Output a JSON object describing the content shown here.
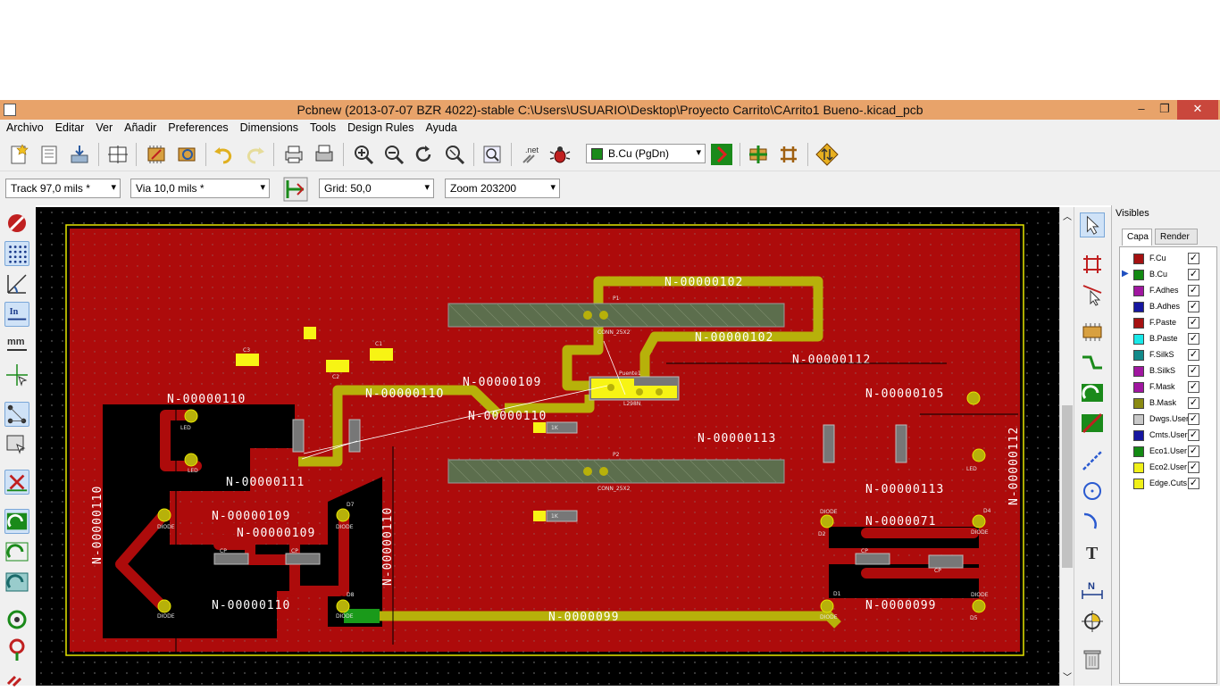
{
  "window": {
    "title": "Pcbnew (2013-07-07 BZR 4022)-stable C:\\Users\\USUARIO\\Desktop\\Proyecto Carrito\\CArrito1 Bueno-.kicad_pcb",
    "minimize": "–",
    "maximize": "❐",
    "close": "✕"
  },
  "menu": [
    "Archivo",
    "Editar",
    "Ver",
    "Añadir",
    "Preferences",
    "Dimensions",
    "Tools",
    "Design Rules",
    "Ayuda"
  ],
  "toolbar": {
    "layer_select": "B.Cu (PgDn)",
    "netlist_label": ".net"
  },
  "toolbar2": {
    "track": "Track 97,0 mils *",
    "via": "Via 10,0 mils *",
    "grid": "Grid: 50,0",
    "zoom": "Zoom 203200"
  },
  "colors": {
    "board": "#ad0b0b",
    "track": "#b7b10a",
    "pad": "#f7f414",
    "edge": "#e6e600",
    "ratsnest": "#ffffff"
  },
  "pcb": {
    "nets": {
      "n102a": "N-00000102",
      "n102b": "N-00000102",
      "n112a": "N-00000112",
      "n112b": "N-00000112",
      "n105": "N-00000105",
      "n110a": "N-00000110",
      "n110b": "N-0000011O",
      "n109a": "N-00000109",
      "n110c": "N-00000110",
      "n113a": "N-00000113",
      "n113b": "N-00000113",
      "n111": "N-00000111",
      "n109b": "N-00000109",
      "n109c": "N-00000109",
      "n110d": "N-00000110",
      "n110e": "N-00000110",
      "n110f": "N-00000110",
      "n071": "N-0000071",
      "n099a": "N-0000099",
      "n099b": "N-0000099"
    },
    "parts": {
      "p1": "P1",
      "p2": "P2",
      "conn1": "CONN_25X2",
      "conn2": "CONN_25X2",
      "puente": "Puente1",
      "l298": "L298N",
      "c2": "C2",
      "c3": "C3",
      "c1": "C1",
      "r1k_a": "1K",
      "r1k_b": "1K",
      "led": "LED",
      "diode": "DIODE",
      "d1": "D1",
      "d2": "D2",
      "d4": "D4",
      "d5": "D5",
      "d7": "D7",
      "d8": "D8",
      "cp": "CP"
    }
  },
  "layers_panel": {
    "title": "Visibles",
    "tabs": [
      "Capa",
      "Render"
    ],
    "layers": [
      {
        "name": "F.Cu",
        "color": "#a51111",
        "checked": "✓"
      },
      {
        "name": "B.Cu",
        "color": "#138a13",
        "checked": "✓",
        "active": true
      },
      {
        "name": "F.Adhes",
        "color": "#a016a0",
        "checked": "✓"
      },
      {
        "name": "B.Adhes",
        "color": "#1616a0",
        "checked": "✓"
      },
      {
        "name": "F.Paste",
        "color": "#a51111",
        "checked": "✓"
      },
      {
        "name": "B.Paste",
        "color": "#18e8e8",
        "checked": "✓"
      },
      {
        "name": "F.SilkS",
        "color": "#128a8a",
        "checked": "✓"
      },
      {
        "name": "B.SilkS",
        "color": "#a016a0",
        "checked": "✓"
      },
      {
        "name": "F.Mask",
        "color": "#a016a0",
        "checked": "✓"
      },
      {
        "name": "B.Mask",
        "color": "#8a8a12",
        "checked": "✓"
      },
      {
        "name": "Dwgs.User",
        "color": "#c8c8c8",
        "checked": "✓"
      },
      {
        "name": "Cmts.User",
        "color": "#1616a0",
        "checked": "✓"
      },
      {
        "name": "Eco1.User",
        "color": "#138a13",
        "checked": "✓"
      },
      {
        "name": "Eco2.User",
        "color": "#f0f018",
        "checked": "✓"
      },
      {
        "name": "Edge.Cuts",
        "color": "#f0f018",
        "checked": "✓"
      }
    ]
  }
}
